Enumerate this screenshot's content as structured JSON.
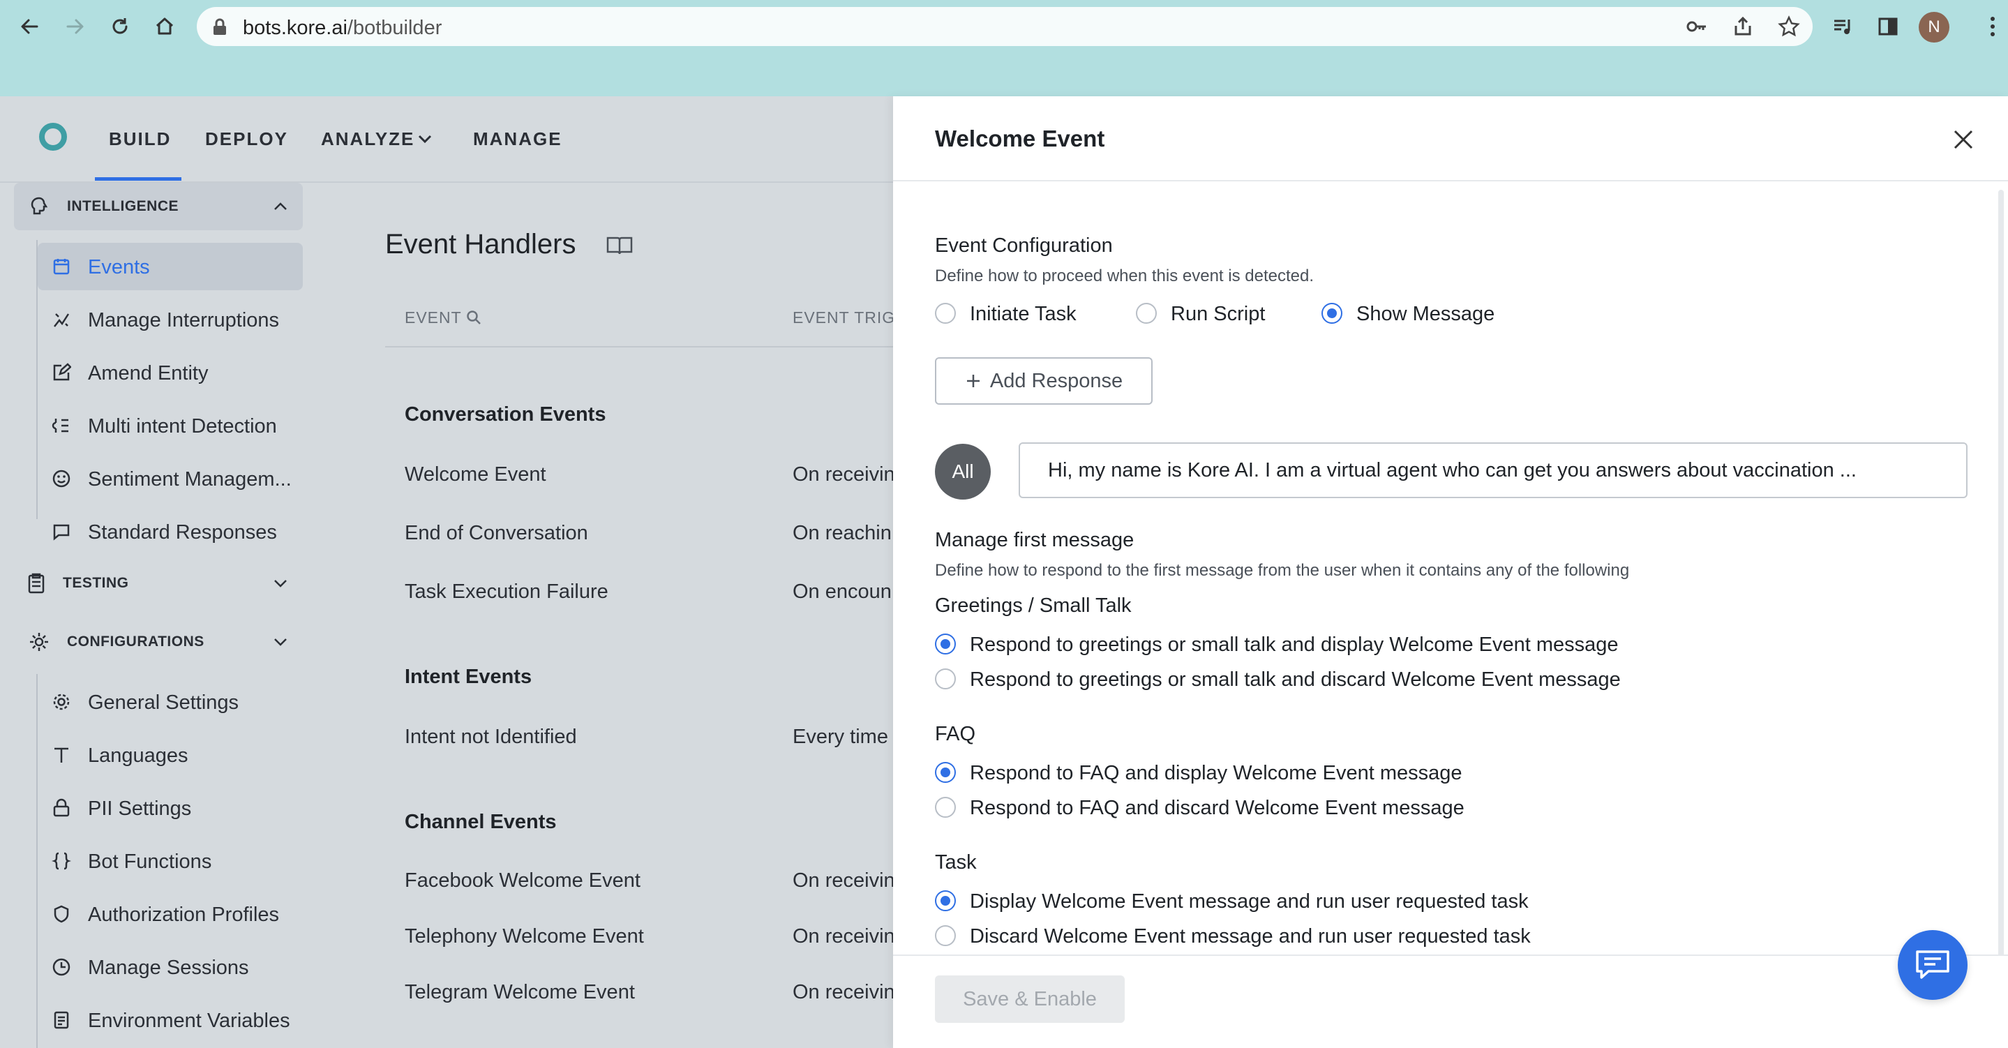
{
  "browser": {
    "url_domain": "bots.kore.ai",
    "url_path": "/botbuilder",
    "profile_initial": "N"
  },
  "topnav": {
    "items": [
      "BUILD",
      "DEPLOY",
      "ANALYZE",
      "MANAGE"
    ]
  },
  "sidebar": {
    "intelligence": {
      "label": "INTELLIGENCE",
      "items": [
        "Events",
        "Manage Interruptions",
        "Amend Entity",
        "Multi intent Detection",
        "Sentiment Managem...",
        "Standard Responses"
      ]
    },
    "testing": {
      "label": "TESTING"
    },
    "configurations": {
      "label": "CONFIGURATIONS",
      "items": [
        "General Settings",
        "Languages",
        "PII Settings",
        "Bot Functions",
        "Authorization Profiles",
        "Manage Sessions",
        "Environment Variables"
      ]
    }
  },
  "main": {
    "title": "Event Handlers",
    "columns": {
      "event": "EVENT",
      "trigger": "EVENT TRIG"
    },
    "groups": [
      {
        "title": "Conversation Events",
        "rows": [
          {
            "name": "Welcome Event",
            "trigger": "On receivin"
          },
          {
            "name": "End of Conversation",
            "trigger": "On reachin"
          },
          {
            "name": "Task Execution Failure",
            "trigger": "On encoun"
          }
        ]
      },
      {
        "title": "Intent Events",
        "rows": [
          {
            "name": "Intent not Identified",
            "trigger": "Every time"
          }
        ]
      },
      {
        "title": "Channel Events",
        "rows": [
          {
            "name": "Facebook Welcome Event",
            "trigger": "On receivin"
          },
          {
            "name": "Telephony Welcome Event",
            "trigger": "On receivin"
          },
          {
            "name": "Telegram Welcome Event",
            "trigger": "On receivin"
          }
        ]
      }
    ]
  },
  "panel": {
    "title": "Welcome Event",
    "config_title": "Event Configuration",
    "config_desc": "Define how to proceed when this event is detected.",
    "options": [
      "Initiate Task",
      "Run Script",
      "Show Message"
    ],
    "selected_option": "Show Message",
    "add_response": "Add Response",
    "badge": "All",
    "message": "Hi, my name is Kore AI. I am a virtual agent who can get you answers about vaccination ...",
    "first_msg_title": "Manage first message",
    "first_msg_desc": "Define how to respond to the first message from the user when it contains any of the following",
    "greetings": {
      "title": "Greetings / Small Talk",
      "opt1": "Respond to greetings or small talk and display Welcome Event message",
      "opt2": "Respond to greetings or small talk and discard Welcome Event message"
    },
    "faq": {
      "title": "FAQ",
      "opt1": "Respond to FAQ and display Welcome Event message",
      "opt2": "Respond to FAQ and discard Welcome Event message"
    },
    "task": {
      "title": "Task",
      "opt1": "Display Welcome Event message and run user requested task",
      "opt2": "Discard Welcome Event message and run user requested task"
    },
    "save_label": "Save & Enable"
  },
  "colors": {
    "accent": "#2f6fe4",
    "brand_teal": "#3f9ea4",
    "chrome": "#b2dfe0"
  }
}
